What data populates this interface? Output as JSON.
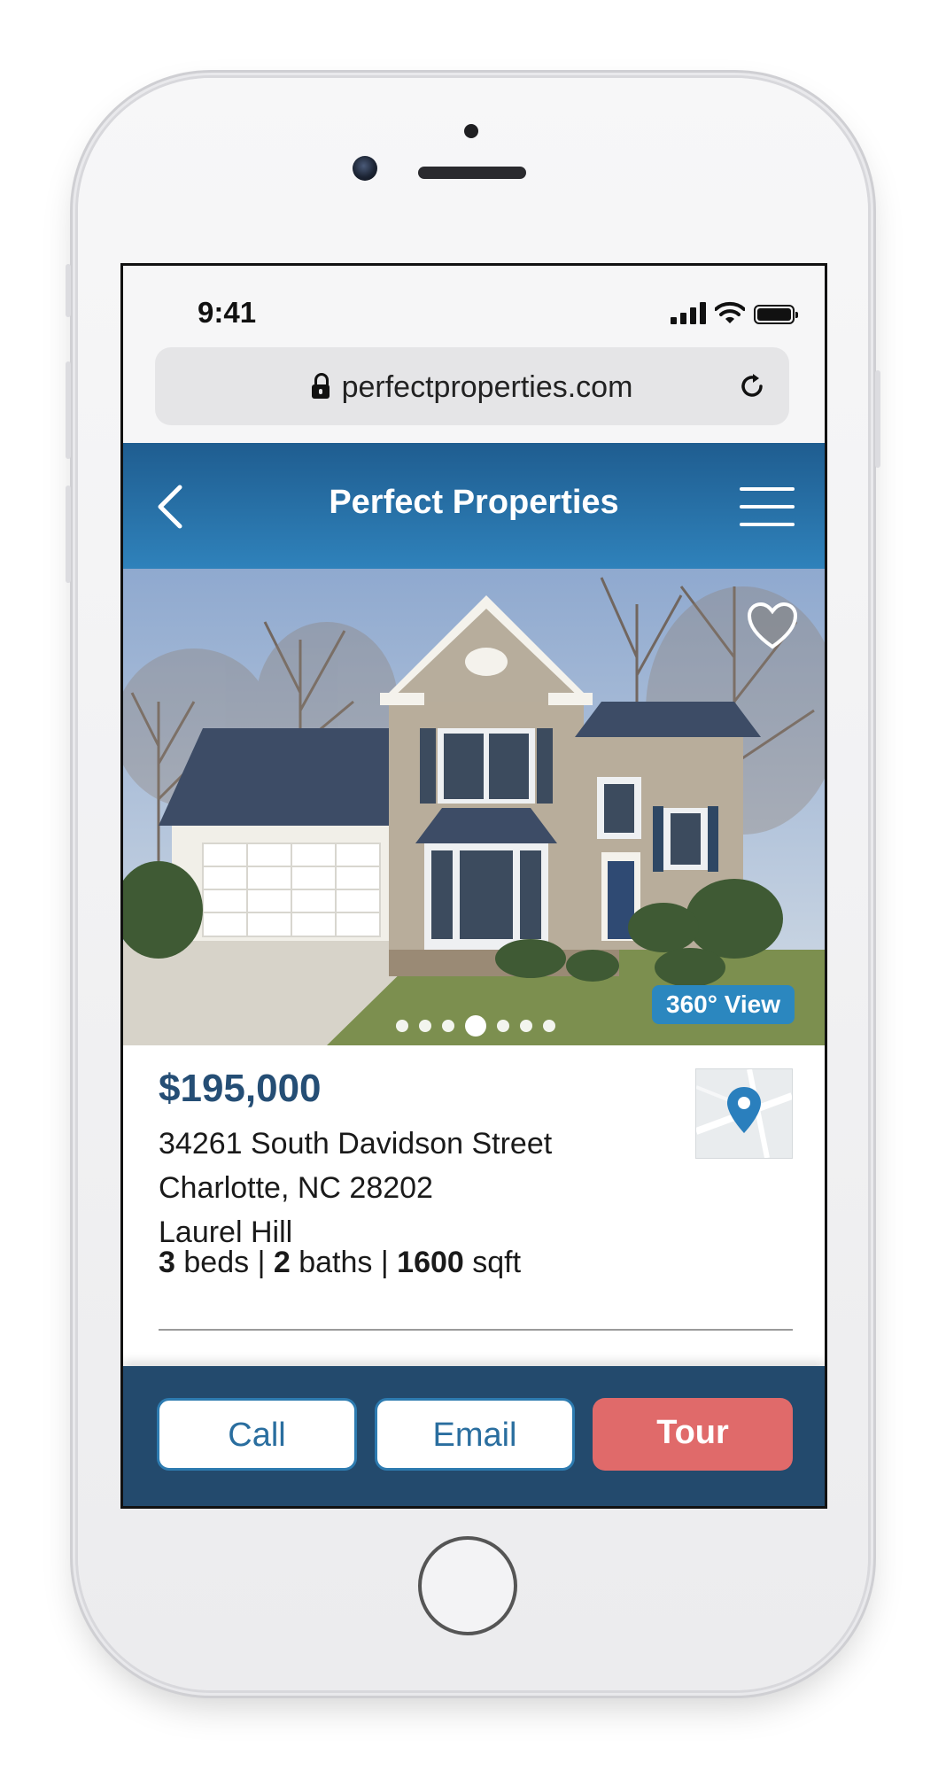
{
  "status_bar": {
    "time": "9:41"
  },
  "browser": {
    "url": "perfectproperties.com"
  },
  "app_header": {
    "title": "Perfect Properties"
  },
  "photo": {
    "view_360_label": "360° View",
    "carousel_dot_count": 7,
    "carousel_active_index": 3
  },
  "listing": {
    "price": "$195,000",
    "address_line1": "34261 South Davidson Street",
    "address_line2": "Charlotte, NC 28202",
    "neighborhood": "Laurel Hill",
    "beds_value": "3",
    "beds_label": "beds",
    "baths_value": "2",
    "baths_label": "baths",
    "sqft_value": "1600",
    "sqft_label": "sqft",
    "separator": "|"
  },
  "actions": {
    "call_label": "Call",
    "email_label": "Email",
    "tour_label": "Tour"
  },
  "colors": {
    "header_blue": "#2f82bb",
    "navy": "#234a6d",
    "price_blue": "#254e75",
    "tour_red": "#e06a6a",
    "badge_blue": "#2b87bf"
  }
}
